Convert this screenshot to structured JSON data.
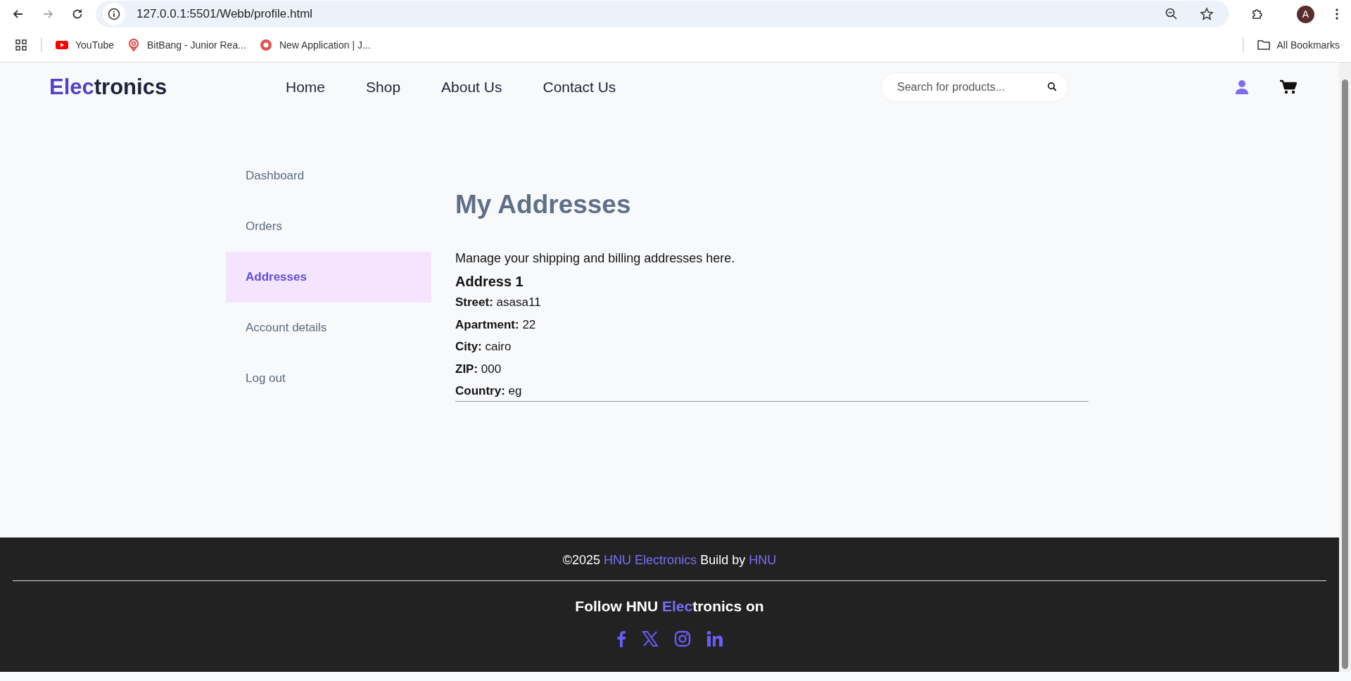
{
  "browser": {
    "url": "127.0.0.1:5501/Webb/profile.html",
    "profile_initial": "A",
    "bookmarks": [
      {
        "kind": "video",
        "label": "YouTube"
      },
      {
        "kind": "pin",
        "label": "BitBang - Junior Rea..."
      },
      {
        "kind": "dot",
        "label": "New Application | J..."
      }
    ],
    "all_bookmarks": "All Bookmarks"
  },
  "header": {
    "logo": [
      {
        "text": "Elec",
        "accent": true
      },
      {
        "text": "tronics",
        "accent": false
      }
    ],
    "nav": [
      "Home",
      "Shop",
      "About Us",
      "Contact Us"
    ],
    "search": {
      "placeholder": "Search for products..."
    }
  },
  "sidebar": {
    "items": [
      {
        "label": "Dashboard",
        "selected": false
      },
      {
        "label": "Orders",
        "selected": false
      },
      {
        "label": "Addresses",
        "selected": true
      },
      {
        "label": "Account details",
        "selected": false
      },
      {
        "label": "Log out",
        "selected": false
      }
    ]
  },
  "content": {
    "title": "My Addresses",
    "intro": "Manage your shipping and billing addresses here.",
    "addresses": [
      {
        "heading": "Address 1",
        "fields": [
          {
            "label": "Street:",
            "value": "asasa11"
          },
          {
            "label": "Apartment:",
            "value": "22"
          },
          {
            "label": "City:",
            "value": "cairo"
          },
          {
            "label": "ZIP:",
            "value": "000"
          },
          {
            "label": "Country:",
            "value": "eg"
          }
        ]
      }
    ]
  },
  "footer": {
    "copyright": [
      {
        "text": "©2025 ",
        "accent": false
      },
      {
        "text": "HNU Electronics",
        "accent": true
      },
      {
        "text": " Build by ",
        "accent": false
      },
      {
        "text": "HNU",
        "accent": true
      }
    ],
    "follow": [
      {
        "text": "Follow HNU ",
        "accent": false
      },
      {
        "text": "Elec",
        "accent": true
      },
      {
        "text": "tronics on",
        "accent": false
      }
    ],
    "socials": [
      {
        "kind": "facebook"
      },
      {
        "kind": "x"
      },
      {
        "kind": "instagram"
      },
      {
        "kind": "linkedin"
      }
    ]
  }
}
